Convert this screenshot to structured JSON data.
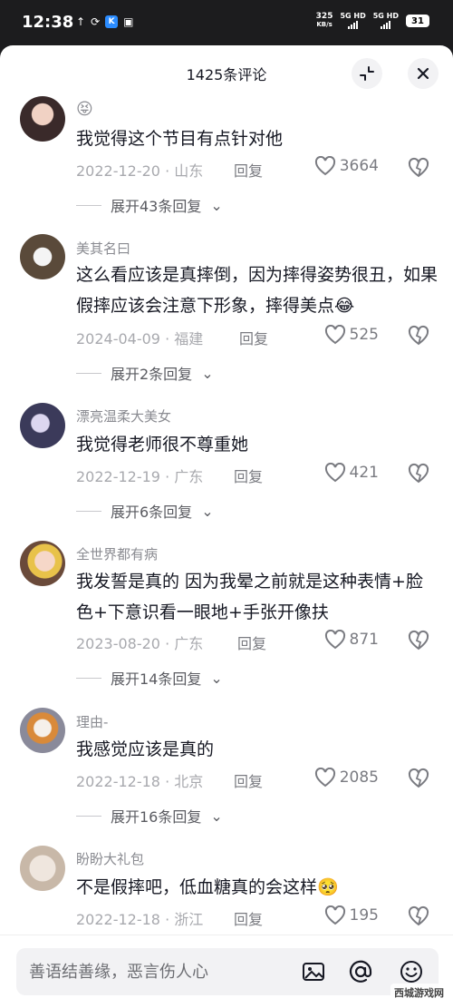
{
  "status_bar": {
    "time": "12:38",
    "speed_value": "325",
    "speed_unit": "KB/s",
    "net1": "5G HD",
    "net2": "5G HD",
    "battery": "31",
    "app_badge": "K"
  },
  "header": {
    "title": "1425条评论",
    "collapse_icon": "collapse-arrows-icon",
    "close_icon": "close-icon"
  },
  "comments": [
    {
      "name": "",
      "name_emoji": "😝",
      "text": "我觉得这个节目有点针对他",
      "date": "2022-12-20",
      "location": "山东",
      "reply_label": "回复",
      "likes": "3664",
      "expand_label": "展开43条回复"
    },
    {
      "name": "美其名曰",
      "text": "这么看应该是真摔倒，因为摔得姿势很丑，如果假摔应该会注意下形象，摔得美点😂",
      "date": "2024-04-09",
      "location": "福建",
      "reply_label": "回复",
      "likes": "525",
      "expand_label": "展开2条回复"
    },
    {
      "name": "漂亮温柔大美女",
      "text": "我觉得老师很不尊重她",
      "date": "2022-12-19",
      "location": "广东",
      "reply_label": "回复",
      "likes": "421",
      "expand_label": "展开6条回复"
    },
    {
      "name": "全世界都有病",
      "text": "我发誓是真的 因为我晕之前就是这种表情+脸色+下意识看一眼地+手张开像扶",
      "date": "2023-08-20",
      "location": "广东",
      "reply_label": "回复",
      "likes": "871",
      "expand_label": "展开14条回复"
    },
    {
      "name": "理由-",
      "text": "我感觉应该是真的",
      "date": "2022-12-18",
      "location": "北京",
      "reply_label": "回复",
      "likes": "2085",
      "expand_label": "展开16条回复"
    },
    {
      "name": "盼盼大礼包",
      "text": "不是假摔吧，低血糖真的会这样🥺",
      "date": "2022-12-18",
      "location": "浙江",
      "reply_label": "回复",
      "likes": "195",
      "expand_label": ""
    }
  ],
  "input": {
    "placeholder": "善语结善缘，恶言伤人心"
  },
  "watermark": "西城游戏网",
  "colors": {
    "text_primary": "#161823",
    "text_secondary": "#a8a9ae",
    "background": "#ffffff"
  }
}
